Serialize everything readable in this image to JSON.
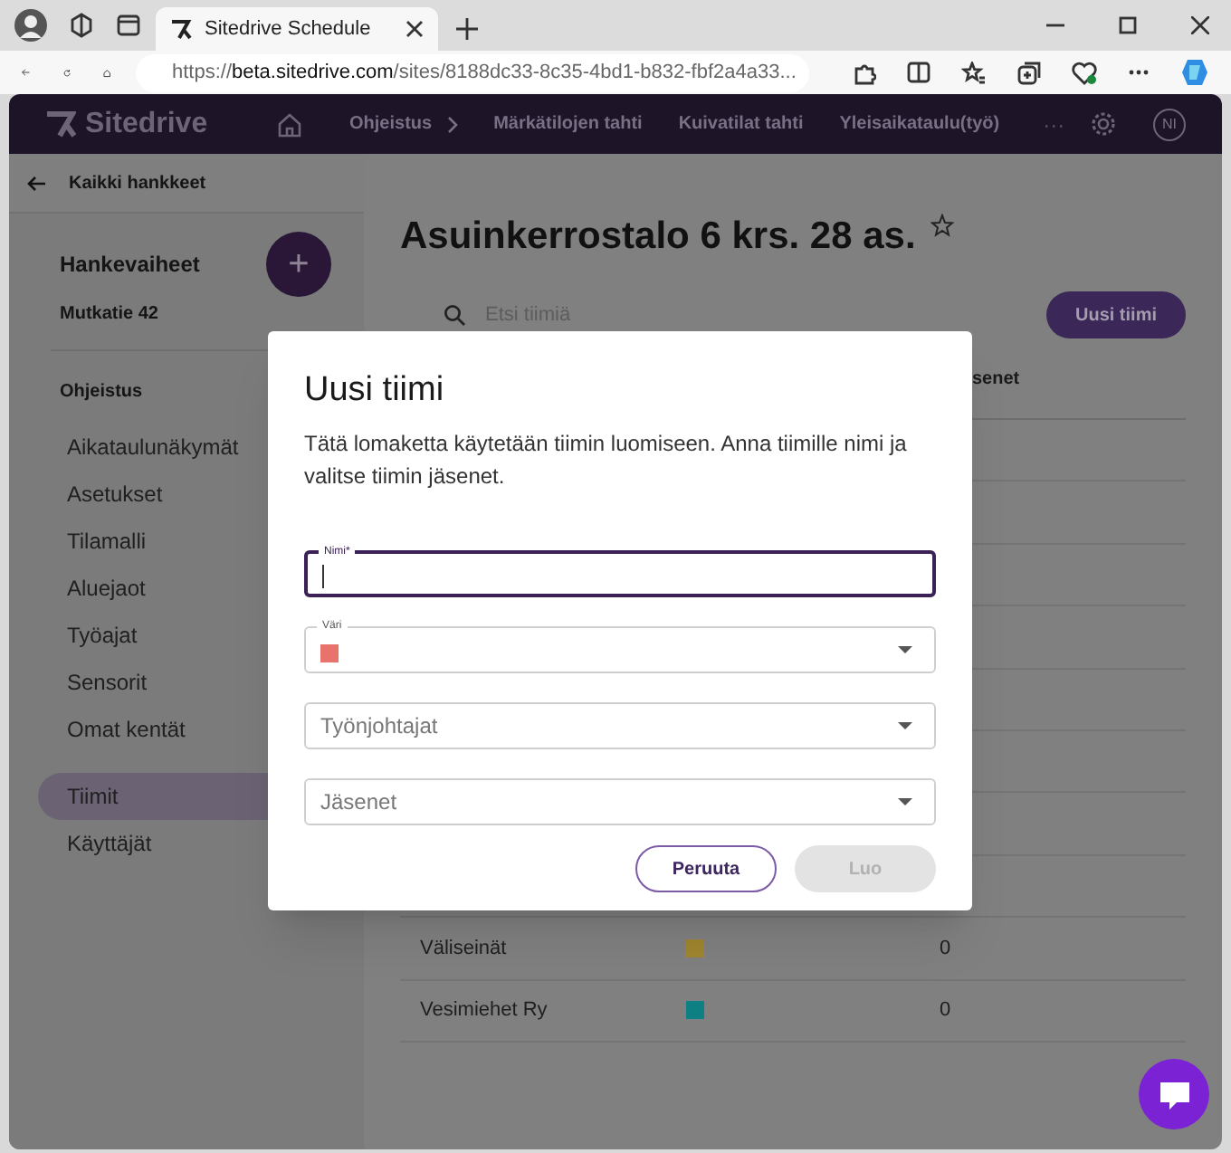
{
  "browser": {
    "tab_title": "Sitedrive Schedule",
    "url_scheme": "https://",
    "url_host": "beta.sitedrive.com",
    "url_path": "/sites/8188dc33-8c35-4bd1-b832-fbf2a4a33..."
  },
  "navbar": {
    "logo": "Sitedrive",
    "items": [
      {
        "label": "Ohjeistus",
        "chevron": true
      },
      {
        "label": "Märkätilojen tahti",
        "chevron": false
      },
      {
        "label": "Kuivatilat tahti",
        "chevron": false
      },
      {
        "label": "Yleisaikataulu(työ)",
        "chevron": false
      }
    ],
    "more": "···",
    "avatar": "NI"
  },
  "sidebar": {
    "back": "Kaikki hankkeet",
    "heading": "Hankevaiheet",
    "add": "+",
    "phase": "Mutkatie 42",
    "section": "Ohjeistus",
    "items": [
      {
        "label": "Aikataulunäkymät",
        "selected": false
      },
      {
        "label": "Asetukset",
        "selected": false
      },
      {
        "label": "Tilamalli",
        "selected": false
      },
      {
        "label": "Aluejaot",
        "selected": false
      },
      {
        "label": "Työajat",
        "selected": false
      },
      {
        "label": "Sensorit",
        "selected": false
      },
      {
        "label": "Omat kentät",
        "selected": false
      }
    ],
    "bottom_items": [
      {
        "label": "Tiimit",
        "selected": true
      },
      {
        "label": "Käyttäjät",
        "selected": false
      }
    ]
  },
  "main": {
    "title": "Asuinkerrostalo 6 krs. 28 as.",
    "search": {
      "placeholder": "Etsi tiimiä"
    },
    "new_button": "Uusi tiimi",
    "table": {
      "column_3": "senet",
      "rows": [
        {
          "name": "Väliseinät",
          "color": "#a08630",
          "count": "0"
        },
        {
          "name": "Vesimiehet Ry",
          "color": "#0e8084",
          "count": "0"
        }
      ]
    }
  },
  "dialog": {
    "title": "Uusi tiimi",
    "description": "Tätä lomaketta käytetään tiimin luomiseen. Anna tiimille nimi ja valitse tiimin jäsenet.",
    "fields": [
      {
        "kind": "text",
        "label": "Nimi*",
        "focused": true
      },
      {
        "kind": "color",
        "label": "Väri",
        "color": "#e8726c",
        "focused": false
      },
      {
        "kind": "select",
        "placeholder": "Työnjohtajat",
        "focused": false
      },
      {
        "kind": "select",
        "placeholder": "Jäsenet",
        "focused": false
      }
    ],
    "buttons": [
      {
        "label": "Peruuta",
        "disabled": false
      },
      {
        "label": "Luo",
        "disabled": true
      }
    ]
  }
}
